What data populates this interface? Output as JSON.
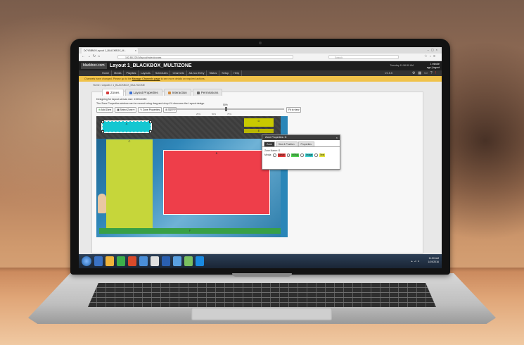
{
  "browser": {
    "tab_title": "DCYBBMX Layout 1_BLACKBOX_M...",
    "url": "192.88.225.5/layout/index#zones",
    "search_placeholder": "Search"
  },
  "app": {
    "logo": "blackbox.com",
    "title": "Layout 1_BLACKBOX_MULTIZONE",
    "user_info": "Tuesday 11:56:50 AM",
    "logout_line1": "1 minute",
    "logout_line2": "ago | logout",
    "version": "V4.5.5"
  },
  "menu": [
    "Home",
    "Media",
    "Playlists",
    "Layouts",
    "Schedules",
    "Channels",
    "Ad-hoc Entry",
    "Status",
    "Setup",
    "Help"
  ],
  "notice": {
    "prefix": "Channels have changed. Please go to the",
    "link": "Manage Channels page",
    "suffix": "to see more details on required actions."
  },
  "breadcrumb": "Home / Layouts / 1_BLACKBOX_MULTIZONE",
  "layout_tabs": [
    {
      "label": "Zones",
      "color": "#d43a3a"
    },
    {
      "label": "Layout Properties",
      "color": "#3a6fd4"
    },
    {
      "label": "Interaction",
      "color": "#d48a3a"
    },
    {
      "label": "Permissions",
      "color": "#6a6a6a"
    }
  ],
  "description": {
    "line1": "Designing for layout canvas size: 1920x1080",
    "line2": "The Zone Properties window can be moved using drag-and-drop if it obscures the Layout design."
  },
  "tools": {
    "add_zone": "Add Zone",
    "select_zone": "Select Zone",
    "zone_properties": "Zone Properties",
    "size": "Size",
    "zoom_value": "50%",
    "tick_1": "25%",
    "tick_2": "50%",
    "tick_3": "75%",
    "fit": "Fit to view",
    "slider_level": 0.5
  },
  "zones": {
    "a": "A",
    "b": "B",
    "c": "C",
    "d": "D",
    "e": "E",
    "f": "F"
  },
  "zone_properties": {
    "title": "Zone Properties: G",
    "tabs": [
      "Zone",
      "Size & Position",
      "Properties"
    ],
    "active_tab": 0,
    "name_label": "Zone Name: G",
    "media_label": "Media:",
    "media_types": [
      {
        "label": "Movie",
        "color": "#e33b3b"
      },
      {
        "label": "HTML",
        "color": "#4fcf4f"
      },
      {
        "label": "Image",
        "color": "#3fd0d0"
      },
      {
        "label": "Text",
        "color": "#e2e23a"
      }
    ]
  },
  "taskbar": {
    "time": "11:50 AM",
    "date": "1/19/2016",
    "apps": [
      "#3a72c4",
      "#f0b43a",
      "#3cae4a",
      "#d84a2a",
      "#4a8ed8",
      "#e0e0e0",
      "#2a5fb0",
      "#5aa0e0",
      "#7ac060",
      "#1a8ae0"
    ]
  }
}
